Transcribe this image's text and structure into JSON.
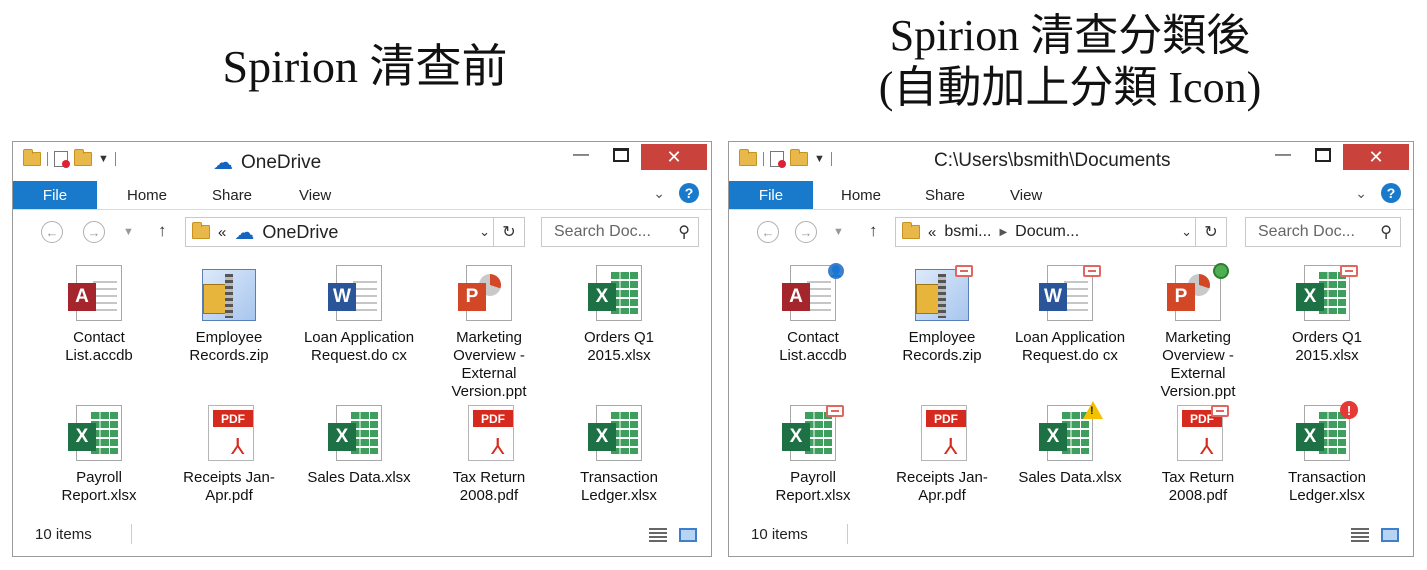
{
  "captions": {
    "left": "Spirion 清查前",
    "right_line1": "Spirion 清查分類後",
    "right_line2": "(自動加上分類 Icon)"
  },
  "windows": [
    {
      "title": "OneDrive",
      "tabs": {
        "file": "File",
        "home": "Home",
        "share": "Share",
        "view": "View"
      },
      "address": {
        "prefix": "«",
        "seg1": "OneDrive",
        "seg2": ""
      },
      "search_placeholder": "Search Doc...",
      "status": "10 items",
      "files": [
        {
          "label": "Contact List.accdb",
          "icon": "access-file-icon",
          "overlay": ""
        },
        {
          "label": "Employee Records.zip",
          "icon": "zip-file-icon",
          "overlay": ""
        },
        {
          "label": "Loan Application Request.do cx",
          "icon": "word-file-icon",
          "overlay": ""
        },
        {
          "label": "Marketing Overview - External Version.ppt",
          "icon": "powerpoint-file-icon",
          "overlay": ""
        },
        {
          "label": "Orders Q1 2015.xlsx",
          "icon": "excel-file-icon",
          "overlay": ""
        },
        {
          "label": "Payroll Report.xlsx",
          "icon": "excel-file-icon",
          "overlay": ""
        },
        {
          "label": "Receipts Jan-Apr.pdf",
          "icon": "pdf-file-icon",
          "overlay": ""
        },
        {
          "label": "Sales Data.xlsx",
          "icon": "excel-file-icon",
          "overlay": ""
        },
        {
          "label": "Tax Return 2008.pdf",
          "icon": "pdf-file-icon",
          "overlay": ""
        },
        {
          "label": "Transaction Ledger.xlsx",
          "icon": "excel-file-icon",
          "overlay": ""
        }
      ]
    },
    {
      "title": "C:\\Users\\bsmith\\Documents",
      "tabs": {
        "file": "File",
        "home": "Home",
        "share": "Share",
        "view": "View"
      },
      "address": {
        "prefix": "«",
        "seg1": "bsmi...",
        "seg2": "Docum..."
      },
      "search_placeholder": "Search Doc...",
      "status": "10 items",
      "files": [
        {
          "label": "Contact List.accdb",
          "icon": "access-file-icon",
          "overlay": "user"
        },
        {
          "label": "Employee Records.zip",
          "icon": "zip-file-icon",
          "overlay": "card"
        },
        {
          "label": "Loan Application Request.do cx",
          "icon": "word-file-icon",
          "overlay": "card"
        },
        {
          "label": "Marketing Overview - External Version.ppt",
          "icon": "powerpoint-file-icon",
          "overlay": "globe"
        },
        {
          "label": "Orders Q1 2015.xlsx",
          "icon": "excel-file-icon",
          "overlay": "card"
        },
        {
          "label": "Payroll Report.xlsx",
          "icon": "excel-file-icon",
          "overlay": "card"
        },
        {
          "label": "Receipts Jan-Apr.pdf",
          "icon": "pdf-file-icon",
          "overlay": ""
        },
        {
          "label": "Sales Data.xlsx",
          "icon": "excel-file-icon",
          "overlay": "warning"
        },
        {
          "label": "Tax Return 2008.pdf",
          "icon": "pdf-file-icon",
          "overlay": "card"
        },
        {
          "label": "Transaction Ledger.xlsx",
          "icon": "excel-file-icon",
          "overlay": "alert"
        }
      ]
    }
  ]
}
